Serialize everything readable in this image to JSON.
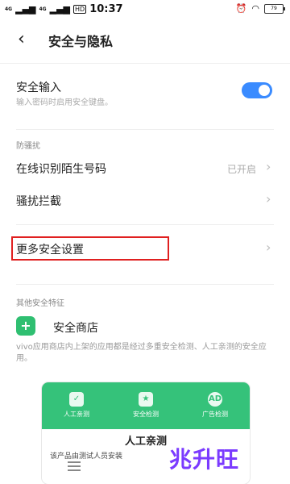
{
  "status_bar": {
    "signal_left": "4G",
    "signal_right": "4G",
    "hd": "HD",
    "time": "10:37",
    "battery": "79"
  },
  "header": {
    "title": "安全与隐私"
  },
  "secure_input": {
    "title": "安全输入",
    "subtitle": "输入密码时启用安全键盘。",
    "toggle_on": true
  },
  "anti_harass": {
    "section_label": "防骚扰",
    "items": [
      {
        "label": "在线识别陌生号码",
        "status": "已开启"
      },
      {
        "label": "骚扰拦截",
        "status": ""
      }
    ]
  },
  "more_settings": {
    "label": "更多安全设置"
  },
  "other_features": {
    "section_label": "其他安全特征",
    "shop_label": "安全商店",
    "description": "vivo应用商店内上架的应用都是经过多重安全检测、人工亲测的安全应用。"
  },
  "card": {
    "tabs": [
      "人工亲测",
      "安全检测",
      "广告检测"
    ],
    "ad_badge": "AD",
    "heading": "人工亲测",
    "text": "该产品由测试人员安装"
  },
  "watermark": {
    "text": "兆升旺"
  },
  "colors": {
    "accent": "#3a8bff",
    "green": "#35c27a",
    "highlight": "#e02020"
  }
}
